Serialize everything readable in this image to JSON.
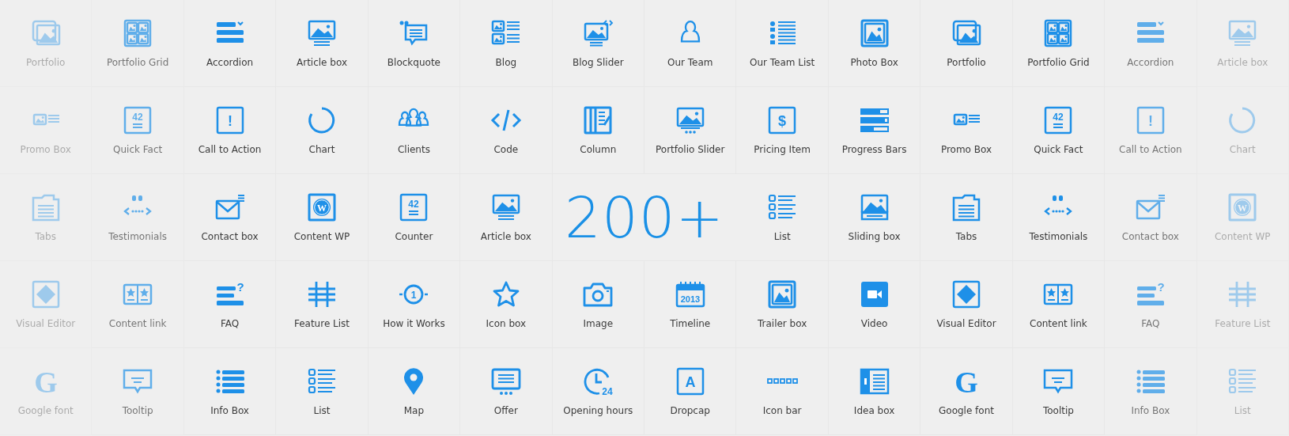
{
  "rows": [
    [
      {
        "label": "Portfolio",
        "kind": "photo",
        "dimmed": true,
        "faint": true
      },
      {
        "label": "Portfolio Grid",
        "kind": "grid",
        "dimmed": true,
        "faint": false
      },
      {
        "label": "Accordion",
        "kind": "accordion",
        "dimmed": false,
        "faint": false
      },
      {
        "label": "Article box",
        "kind": "monitor",
        "dimmed": false,
        "faint": false
      },
      {
        "label": "Blockquote",
        "kind": "quote",
        "dimmed": false,
        "faint": false
      },
      {
        "label": "Blog",
        "kind": "blog",
        "dimmed": false,
        "faint": false
      },
      {
        "label": "Blog Slider",
        "kind": "slider",
        "dimmed": false,
        "faint": false
      },
      {
        "label": "Our Team",
        "kind": "person",
        "dimmed": false,
        "faint": false
      },
      {
        "label": "Our Team List",
        "kind": "teamlist",
        "dimmed": false,
        "faint": false
      },
      {
        "label": "Photo Box",
        "kind": "photobox",
        "dimmed": false,
        "faint": false
      },
      {
        "label": "Portfolio",
        "kind": "photo",
        "dimmed": false,
        "faint": false
      },
      {
        "label": "Portfolio Grid",
        "kind": "grid",
        "dimmed": false,
        "faint": false
      },
      {
        "label": "Accordion",
        "kind": "accordion",
        "dimmed": true,
        "faint": false
      },
      {
        "label": "Article box",
        "kind": "monitor",
        "dimmed": true,
        "faint": true
      }
    ],
    [
      {
        "label": "Promo Box",
        "kind": "promo",
        "dimmed": true,
        "faint": true
      },
      {
        "label": "Quick Fact",
        "kind": "fact",
        "glyph": "42",
        "dimmed": true,
        "faint": false
      },
      {
        "label": "Call to Action",
        "kind": "alert",
        "glyph": "!",
        "dimmed": false,
        "faint": false
      },
      {
        "label": "Chart",
        "kind": "chart",
        "dimmed": false,
        "faint": false
      },
      {
        "label": "Clients",
        "kind": "clients",
        "dimmed": false,
        "faint": false
      },
      {
        "label": "Code",
        "kind": "code",
        "dimmed": false,
        "faint": false
      },
      {
        "label": "Column",
        "kind": "column",
        "dimmed": false,
        "faint": false
      },
      {
        "label": "Portfolio Slider",
        "kind": "slideshow",
        "dimmed": false,
        "faint": false
      },
      {
        "label": "Pricing Item",
        "kind": "alert",
        "glyph": "$",
        "dimmed": false,
        "faint": false
      },
      {
        "label": "Progress Bars",
        "kind": "bars",
        "dimmed": false,
        "faint": false
      },
      {
        "label": "Promo Box",
        "kind": "promo",
        "dimmed": false,
        "faint": false
      },
      {
        "label": "Quick Fact",
        "kind": "fact",
        "glyph": "42",
        "dimmed": false,
        "faint": false
      },
      {
        "label": "Call to Action",
        "kind": "alert",
        "glyph": "!",
        "dimmed": true,
        "faint": false
      },
      {
        "label": "Chart",
        "kind": "chart",
        "dimmed": true,
        "faint": true
      }
    ],
    [
      {
        "label": "Tabs",
        "kind": "tabs",
        "dimmed": true,
        "faint": true
      },
      {
        "label": "Testimonials",
        "kind": "testimonial",
        "dimmed": true,
        "faint": false
      },
      {
        "label": "Contact box",
        "kind": "mail",
        "dimmed": false,
        "faint": false
      },
      {
        "label": "Content WP",
        "kind": "wordpress",
        "glyph": "W",
        "dimmed": false,
        "faint": false
      },
      {
        "label": "Counter",
        "kind": "fact",
        "glyph": "42",
        "dimmed": false,
        "faint": false
      },
      {
        "label": "Article box",
        "kind": "monitor",
        "dimmed": false,
        "faint": false
      },
      {
        "label": "200+",
        "kind": "number",
        "dimmed": false,
        "faint": false
      },
      {
        "label": "List",
        "kind": "list",
        "dimmed": false,
        "faint": false
      },
      {
        "label": "Sliding box",
        "kind": "sliding",
        "dimmed": false,
        "faint": false
      },
      {
        "label": "Tabs",
        "kind": "tabs",
        "dimmed": false,
        "faint": false
      },
      {
        "label": "Testimonials",
        "kind": "testimonial",
        "dimmed": false,
        "faint": false
      },
      {
        "label": "Contact box",
        "kind": "mail",
        "dimmed": true,
        "faint": false
      },
      {
        "label": "Content WP",
        "kind": "wordpress",
        "glyph": "W",
        "dimmed": true,
        "faint": true
      }
    ],
    [
      {
        "label": "Visual Editor",
        "kind": "visual",
        "dimmed": true,
        "faint": true
      },
      {
        "label": "Content link",
        "kind": "contentlink",
        "dimmed": true,
        "faint": false
      },
      {
        "label": "FAQ",
        "kind": "faq",
        "glyph": "?",
        "dimmed": false,
        "faint": false
      },
      {
        "label": "Feature List",
        "kind": "hash",
        "dimmed": false,
        "faint": false
      },
      {
        "label": "How it Works",
        "kind": "step",
        "glyph": "1",
        "dimmed": false,
        "faint": false
      },
      {
        "label": "Icon box",
        "kind": "star",
        "dimmed": false,
        "faint": false
      },
      {
        "label": "Image",
        "kind": "camera",
        "dimmed": false,
        "faint": false
      },
      {
        "label": "Timeline",
        "kind": "calendar",
        "glyph": "2013",
        "dimmed": false,
        "faint": false
      },
      {
        "label": "Trailer box",
        "kind": "photobox",
        "dimmed": false,
        "faint": false
      },
      {
        "label": "Video",
        "kind": "video",
        "dimmed": false,
        "faint": false
      },
      {
        "label": "Visual Editor",
        "kind": "visual",
        "dimmed": false,
        "faint": false
      },
      {
        "label": "Content link",
        "kind": "contentlink",
        "dimmed": false,
        "faint": false
      },
      {
        "label": "FAQ",
        "kind": "faq",
        "glyph": "?",
        "dimmed": true,
        "faint": false
      },
      {
        "label": "Feature List",
        "kind": "hash",
        "dimmed": true,
        "faint": true
      }
    ],
    [
      {
        "label": "Google font",
        "kind": "letter",
        "glyph": "G",
        "dimmed": true,
        "faint": true
      },
      {
        "label": "Tooltip",
        "kind": "tooltip",
        "dimmed": true,
        "faint": false
      },
      {
        "label": "Info Box",
        "kind": "infobox",
        "dimmed": false,
        "faint": false
      },
      {
        "label": "List",
        "kind": "list",
        "dimmed": false,
        "faint": false
      },
      {
        "label": "Map",
        "kind": "pin",
        "dimmed": false,
        "faint": false
      },
      {
        "label": "Offer",
        "kind": "offer",
        "dimmed": false,
        "faint": false
      },
      {
        "label": "Opening hours",
        "kind": "clock",
        "glyph": "24",
        "dimmed": false,
        "faint": false
      },
      {
        "label": "Dropcap",
        "kind": "alert",
        "glyph": "A",
        "dimmed": false,
        "faint": false
      },
      {
        "label": "Icon bar",
        "kind": "iconbar",
        "dimmed": false,
        "faint": false
      },
      {
        "label": "Idea box",
        "kind": "idea",
        "dimmed": false,
        "faint": false
      },
      {
        "label": "Google font",
        "kind": "letter",
        "glyph": "G",
        "dimmed": false,
        "faint": false
      },
      {
        "label": "Tooltip",
        "kind": "tooltip",
        "dimmed": false,
        "faint": false
      },
      {
        "label": "Info Box",
        "kind": "infobox",
        "dimmed": true,
        "faint": false
      },
      {
        "label": "List",
        "kind": "list",
        "dimmed": true,
        "faint": true
      }
    ]
  ]
}
